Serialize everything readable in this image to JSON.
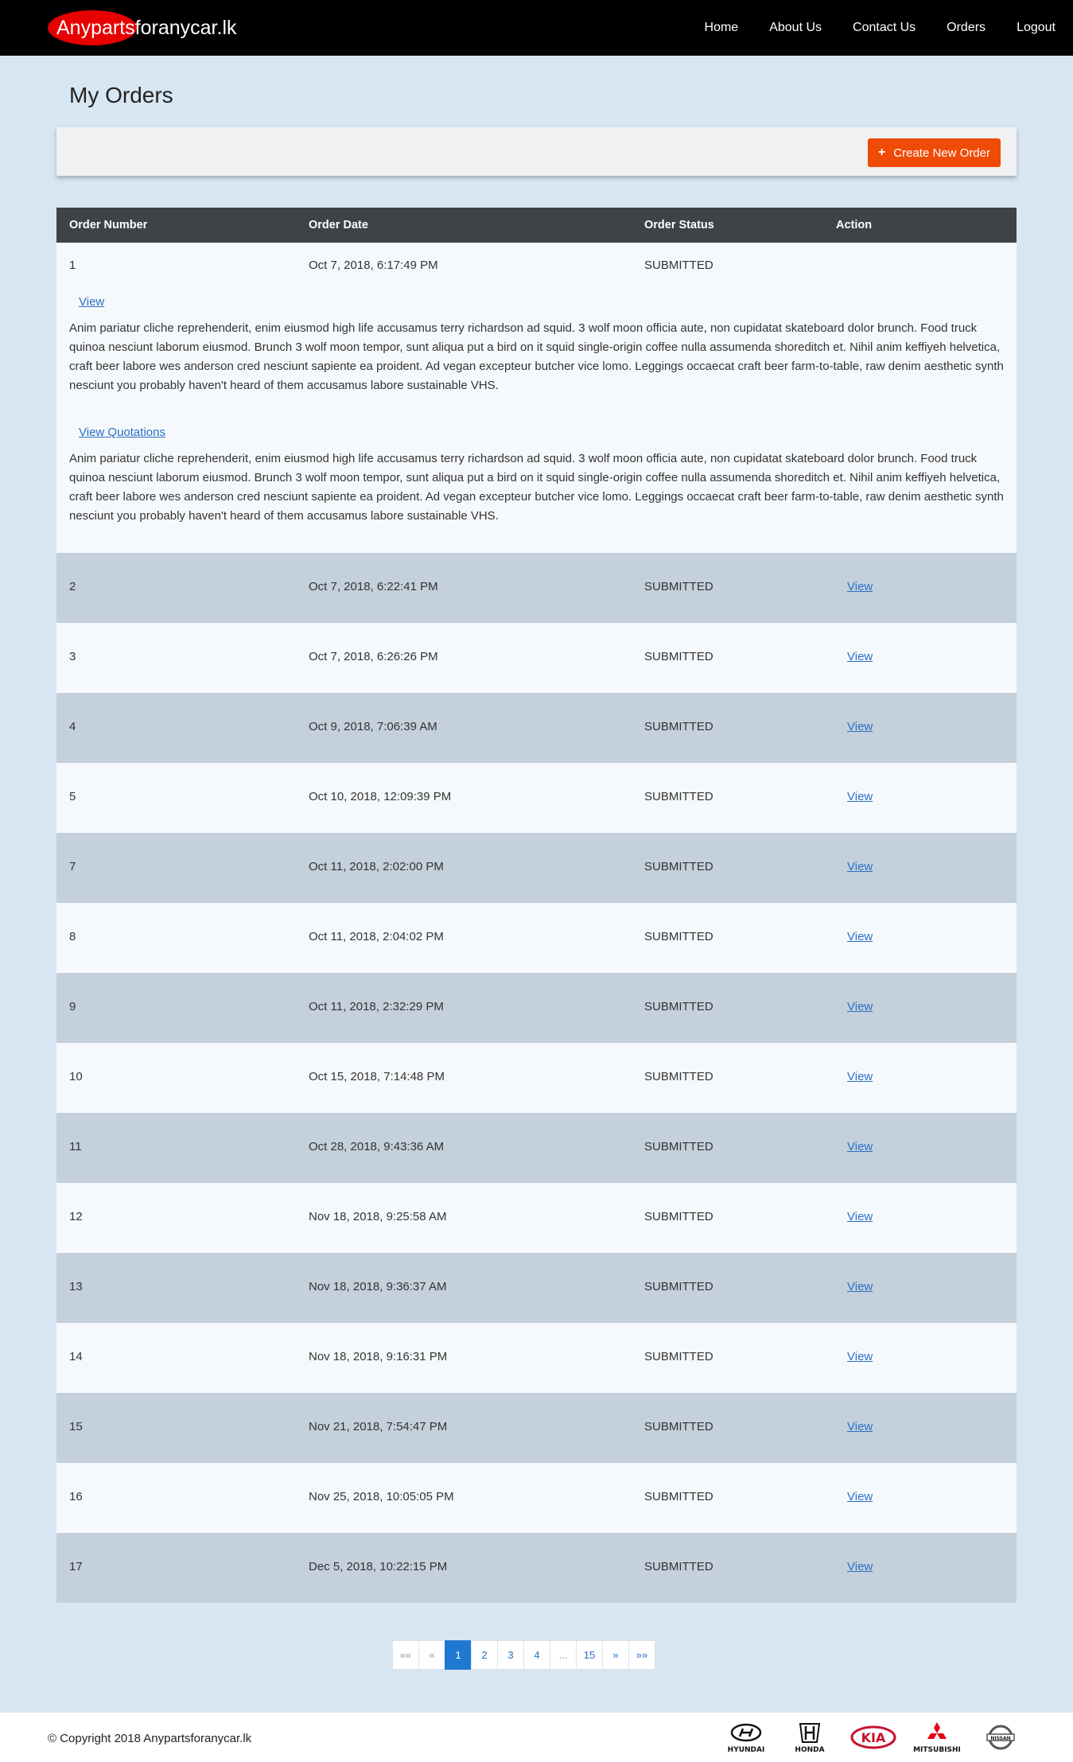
{
  "header": {
    "brand_part1": "Anyparts",
    "brand_part2": "foranycar.lk",
    "nav": [
      "Home",
      "About Us",
      "Contact Us",
      "Orders",
      "Logout"
    ]
  },
  "page": {
    "title": "My Orders",
    "create_button": "Create New Order"
  },
  "table": {
    "columns": [
      "Order Number",
      "Order Date",
      "Order Status",
      "Action"
    ],
    "expanded": {
      "number": "1",
      "date": "Oct 7, 2018, 6:17:49 PM",
      "status": "SUBMITTED",
      "view_link": "View",
      "para1": "Anim pariatur cliche reprehenderit, enim eiusmod high life accusamus terry richardson ad squid. 3 wolf moon officia aute, non cupidatat skateboard dolor brunch. Food truck quinoa nesciunt laborum eiusmod. Brunch 3 wolf moon tempor, sunt aliqua put a bird on it squid single-origin coffee nulla assumenda shoreditch et. Nihil anim keffiyeh helvetica, craft beer labore wes anderson cred nesciunt sapiente ea proident. Ad vegan excepteur butcher vice lomo. Leggings occaecat craft beer farm-to-table, raw denim aesthetic synth nesciunt you probably haven't heard of them accusamus labore sustainable VHS.",
      "quotations_link": "View Quotations",
      "para2": "Anim pariatur cliche reprehenderit, enim eiusmod high life accusamus terry richardson ad squid. 3 wolf moon officia aute, non cupidatat skateboard dolor brunch. Food truck quinoa nesciunt laborum eiusmod. Brunch 3 wolf moon tempor, sunt aliqua put a bird on it squid single-origin coffee nulla assumenda shoreditch et. Nihil anim keffiyeh helvetica, craft beer labore wes anderson cred nesciunt sapiente ea proident. Ad vegan excepteur butcher vice lomo. Leggings occaecat craft beer farm-to-table, raw denim aesthetic synth nesciunt you probably haven't heard of them accusamus labore sustainable VHS."
    },
    "rows": [
      {
        "number": "2",
        "date": "Oct 7, 2018, 6:22:41 PM",
        "status": "SUBMITTED",
        "action": "View"
      },
      {
        "number": "3",
        "date": "Oct 7, 2018, 6:26:26 PM",
        "status": "SUBMITTED",
        "action": "View"
      },
      {
        "number": "4",
        "date": "Oct 9, 2018, 7:06:39 AM",
        "status": "SUBMITTED",
        "action": "View"
      },
      {
        "number": "5",
        "date": "Oct 10, 2018, 12:09:39 PM",
        "status": "SUBMITTED",
        "action": "View"
      },
      {
        "number": "7",
        "date": "Oct 11, 2018, 2:02:00 PM",
        "status": "SUBMITTED",
        "action": "View"
      },
      {
        "number": "8",
        "date": "Oct 11, 2018, 2:04:02 PM",
        "status": "SUBMITTED",
        "action": "View"
      },
      {
        "number": "9",
        "date": "Oct 11, 2018, 2:32:29 PM",
        "status": "SUBMITTED",
        "action": "View"
      },
      {
        "number": "10",
        "date": "Oct 15, 2018, 7:14:48 PM",
        "status": "SUBMITTED",
        "action": "View"
      },
      {
        "number": "11",
        "date": "Oct 28, 2018, 9:43:36 AM",
        "status": "SUBMITTED",
        "action": "View"
      },
      {
        "number": "12",
        "date": "Nov 18, 2018, 9:25:58 AM",
        "status": "SUBMITTED",
        "action": "View"
      },
      {
        "number": "13",
        "date": "Nov 18, 2018, 9:36:37 AM",
        "status": "SUBMITTED",
        "action": "View"
      },
      {
        "number": "14",
        "date": "Nov 18, 2018, 9:16:31 PM",
        "status": "SUBMITTED",
        "action": "View"
      },
      {
        "number": "15",
        "date": "Nov 21, 2018, 7:54:47 PM",
        "status": "SUBMITTED",
        "action": "View"
      },
      {
        "number": "16",
        "date": "Nov 25, 2018, 10:05:05 PM",
        "status": "SUBMITTED",
        "action": "View"
      },
      {
        "number": "17",
        "date": "Dec 5, 2018, 10:22:15 PM",
        "status": "SUBMITTED",
        "action": "View"
      }
    ]
  },
  "pagination": {
    "items": [
      "««",
      "«",
      "1",
      "2",
      "3",
      "4",
      "...",
      "15",
      "»",
      "»»"
    ],
    "active": "1"
  },
  "footer": {
    "copyright": "© Copyright 2018 Anypartsforanycar.lk",
    "logos": [
      {
        "icon": "hyundai-logo-icon",
        "word": "HYUNDAI"
      },
      {
        "icon": "honda-logo-icon",
        "word": "HONDA"
      },
      {
        "icon": "kia-logo-icon",
        "word": ""
      },
      {
        "icon": "mitsubishi-logo-icon",
        "word": "MITSUBISHI"
      },
      {
        "icon": "nissan-logo-icon",
        "word": ""
      }
    ]
  },
  "colors": {
    "accent": "#f04a07",
    "link": "#2a6fc4",
    "header_bg": "#000000",
    "table_header": "#3f4247",
    "row_alt": "#c4d0db"
  }
}
